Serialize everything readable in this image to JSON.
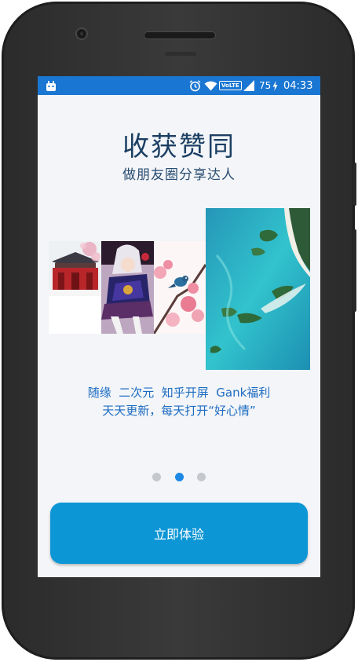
{
  "status_bar": {
    "volte_label": "VoLTE",
    "battery_percent": "75",
    "time": "04:33",
    "icons": [
      "android-notification-icon",
      "alarm-icon",
      "wifi-icon",
      "volte-icon",
      "signal-icon",
      "battery-charging-icon"
    ]
  },
  "onboarding": {
    "title": "收获赞同",
    "subtitle": "做朋友圈分享达人",
    "caption_line1": "随缘  二次元  知乎开屏  Gank福利",
    "caption_line2": "天天更新，每天打开“好心情”",
    "images": [
      "red-temple-plum-blossom",
      "anime-character-art",
      "pink-blossom-bird",
      "aerial-turquoise-lagoon"
    ],
    "page_indicator": {
      "total": 3,
      "active_index": 1
    },
    "cta_label": "立即体验"
  },
  "colors": {
    "status_bar": "#1976d2",
    "title": "#1c3f63",
    "caption": "#1c6cc2",
    "cta": "#0d96d6",
    "dot_active": "#1e88e5",
    "dot_inactive": "#c4c7cc"
  }
}
